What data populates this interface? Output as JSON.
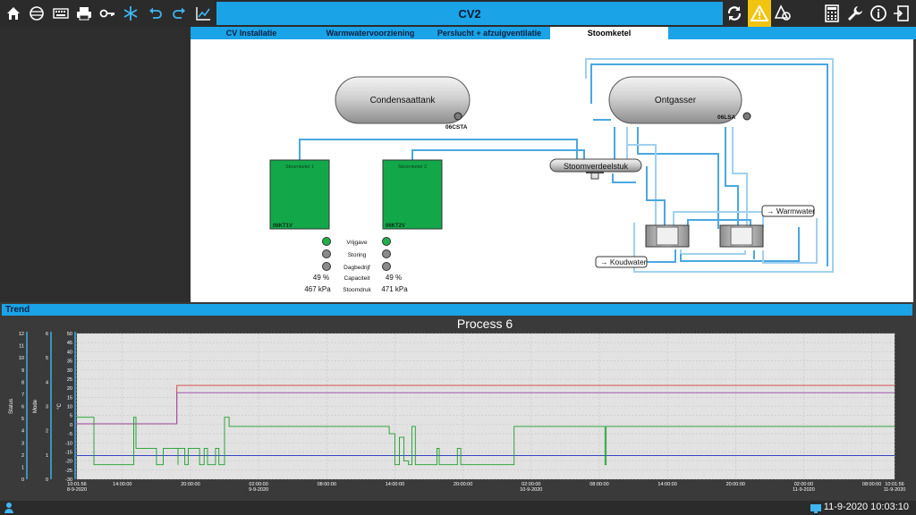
{
  "header": {
    "title": "CV2",
    "left_icons": [
      "home-icon",
      "globe-icon",
      "keyboard-icon",
      "printer-icon",
      "key-icon",
      "snowflake-icon",
      "undo-icon",
      "redo-icon",
      "chart-icon"
    ],
    "right_icons": [
      "refresh-icon",
      "warning-icon",
      "alarm-shapes-icon",
      "calculator-icon",
      "wrench-icon",
      "info-icon",
      "exit-icon"
    ]
  },
  "tabs": [
    {
      "label": "CV Installatie"
    },
    {
      "label": "Warmwatervoorziening"
    },
    {
      "label": "Perslucht + afzuigventilatie"
    },
    {
      "label": "Stoomketel"
    }
  ],
  "schematic": {
    "condensaattank": {
      "label": "Condensaattank",
      "tag": "06CSTA"
    },
    "ontgasser": {
      "label": "Ontgasser",
      "tag": "06LSA"
    },
    "stoomverdeelstuk": {
      "label": "Stoomverdeelstuk"
    },
    "warmwater": {
      "label": "→ Warmwater"
    },
    "koudwater": {
      "label": "→ Koudwater"
    },
    "ketel1": {
      "label": "Stoomketel 1",
      "tag": "06KT1V",
      "capaciteit": "49 %",
      "stoomdruk": "467 kPa"
    },
    "ketel2": {
      "label": "Stoomketel 2",
      "tag": "06KT2V",
      "capaciteit": "49 %",
      "stoomdruk": "471 kPa"
    },
    "status_labels": [
      "Vrijgave",
      "Storing",
      "Dagbedrijf",
      "Capaciteit",
      "Stoomdruk"
    ],
    "colors": {
      "boiler": "#12a84a",
      "pipe": "#4aa8e0",
      "ok": "#1fb04b",
      "off": "#8a8a8a"
    }
  },
  "trend": {
    "section_label": "Trend",
    "chart_data": {
      "type": "line",
      "title": "Process 6",
      "axes": [
        {
          "label": "Status",
          "ticks": [
            "0",
            "1",
            "2",
            "3",
            "4",
            "5",
            "6",
            "7",
            "8",
            "9",
            "10",
            "11",
            "12"
          ],
          "range": [
            0,
            12
          ]
        },
        {
          "label": "Mode",
          "ticks": [
            "0",
            "1",
            "2",
            "3",
            "4",
            "5",
            "6"
          ],
          "range": [
            0,
            6
          ]
        },
        {
          "label": "°C",
          "ticks": [
            "-30",
            "-25",
            "-20",
            "-15",
            "-10",
            "-5",
            "0",
            "5",
            "10",
            "15",
            "20",
            "25",
            "30",
            "35",
            "40",
            "45",
            "50"
          ],
          "range": [
            -30,
            50
          ]
        }
      ],
      "x_ticks": [
        {
          "time": "10:01:56",
          "date": "8-9-2020"
        },
        {
          "time": "14:00:00",
          "date": ""
        },
        {
          "time": "20:00:00",
          "date": ""
        },
        {
          "time": "02:00:00",
          "date": "9-9-2020"
        },
        {
          "time": "08:00:00",
          "date": ""
        },
        {
          "time": "14:00:00",
          "date": ""
        },
        {
          "time": "20:00:00",
          "date": ""
        },
        {
          "time": "02:00:00",
          "date": "10-9-2020"
        },
        {
          "time": "08:00:00",
          "date": ""
        },
        {
          "time": "14:00:00",
          "date": ""
        },
        {
          "time": "20:00:00",
          "date": ""
        },
        {
          "time": "02:00:00",
          "date": "11-9-2020"
        },
        {
          "time": "08:00:00",
          "date": ""
        },
        {
          "time": "10:01:56",
          "date": "11-9-2020"
        }
      ],
      "x_range_hours": [
        0,
        72
      ],
      "grid": true,
      "series": [
        {
          "color": "#d23b3b",
          "axis": "°C",
          "points": [
            [
              0,
              0.5
            ],
            [
              8.8,
              0.5
            ],
            [
              8.8,
              21.5
            ],
            [
              72,
              21.5
            ]
          ]
        },
        {
          "color": "#9b3fa8",
          "axis": "°C",
          "points": [
            [
              0,
              0.5
            ],
            [
              8.8,
              0.5
            ],
            [
              8.8,
              17.5
            ],
            [
              72,
              17.5
            ]
          ]
        },
        {
          "color": "#3446c2",
          "axis": "°C",
          "points": [
            [
              0,
              -17
            ],
            [
              72,
              -17
            ]
          ]
        },
        {
          "color": "#1a9e2a",
          "axis": "°C",
          "points": [
            [
              0,
              4
            ],
            [
              1.5,
              4
            ],
            [
              1.5,
              -22
            ],
            [
              5,
              -22
            ],
            [
              5,
              4
            ],
            [
              5.2,
              4
            ],
            [
              5.2,
              -13
            ],
            [
              7,
              -13
            ],
            [
              7,
              -22
            ],
            [
              7.6,
              -22
            ],
            [
              7.6,
              -13
            ],
            [
              8.9,
              -13
            ],
            [
              8.9,
              -22
            ],
            [
              8.9,
              -13
            ],
            [
              9.5,
              -13
            ],
            [
              9.5,
              -22
            ],
            [
              9.8,
              -22
            ],
            [
              9.8,
              -13
            ],
            [
              10.8,
              -13
            ],
            [
              10.8,
              -22
            ],
            [
              11.2,
              -22
            ],
            [
              11.2,
              -13
            ],
            [
              11.5,
              -13
            ],
            [
              11.5,
              -22
            ],
            [
              12.2,
              -22
            ],
            [
              12.2,
              -13
            ],
            [
              12.5,
              -13
            ],
            [
              12.5,
              -22
            ],
            [
              13,
              -22
            ],
            [
              13,
              4
            ],
            [
              13.4,
              4
            ],
            [
              13.4,
              -1
            ],
            [
              27.5,
              -1
            ],
            [
              27.5,
              -5
            ],
            [
              28,
              -5
            ],
            [
              28,
              -22
            ],
            [
              28.4,
              -22
            ],
            [
              28.4,
              -7
            ],
            [
              28.8,
              -7
            ],
            [
              28.8,
              -20
            ],
            [
              29.2,
              -20
            ],
            [
              29.2,
              -22
            ],
            [
              29.5,
              -22
            ],
            [
              29.5,
              -1
            ],
            [
              29.8,
              -1
            ],
            [
              29.8,
              -22
            ],
            [
              31.7,
              -22
            ],
            [
              31.7,
              -13
            ],
            [
              31.9,
              -13
            ],
            [
              31.9,
              -22
            ],
            [
              33.5,
              -22
            ],
            [
              33.5,
              -13
            ],
            [
              33.8,
              -13
            ],
            [
              33.8,
              -22
            ],
            [
              38.5,
              -22
            ],
            [
              38.5,
              -1
            ],
            [
              46.5,
              -1
            ],
            [
              46.5,
              -22
            ],
            [
              46.6,
              -22
            ],
            [
              46.6,
              -1
            ],
            [
              72,
              -1
            ]
          ]
        }
      ]
    }
  },
  "statusbar": {
    "datetime": "11-9-2020 10:03:10"
  }
}
